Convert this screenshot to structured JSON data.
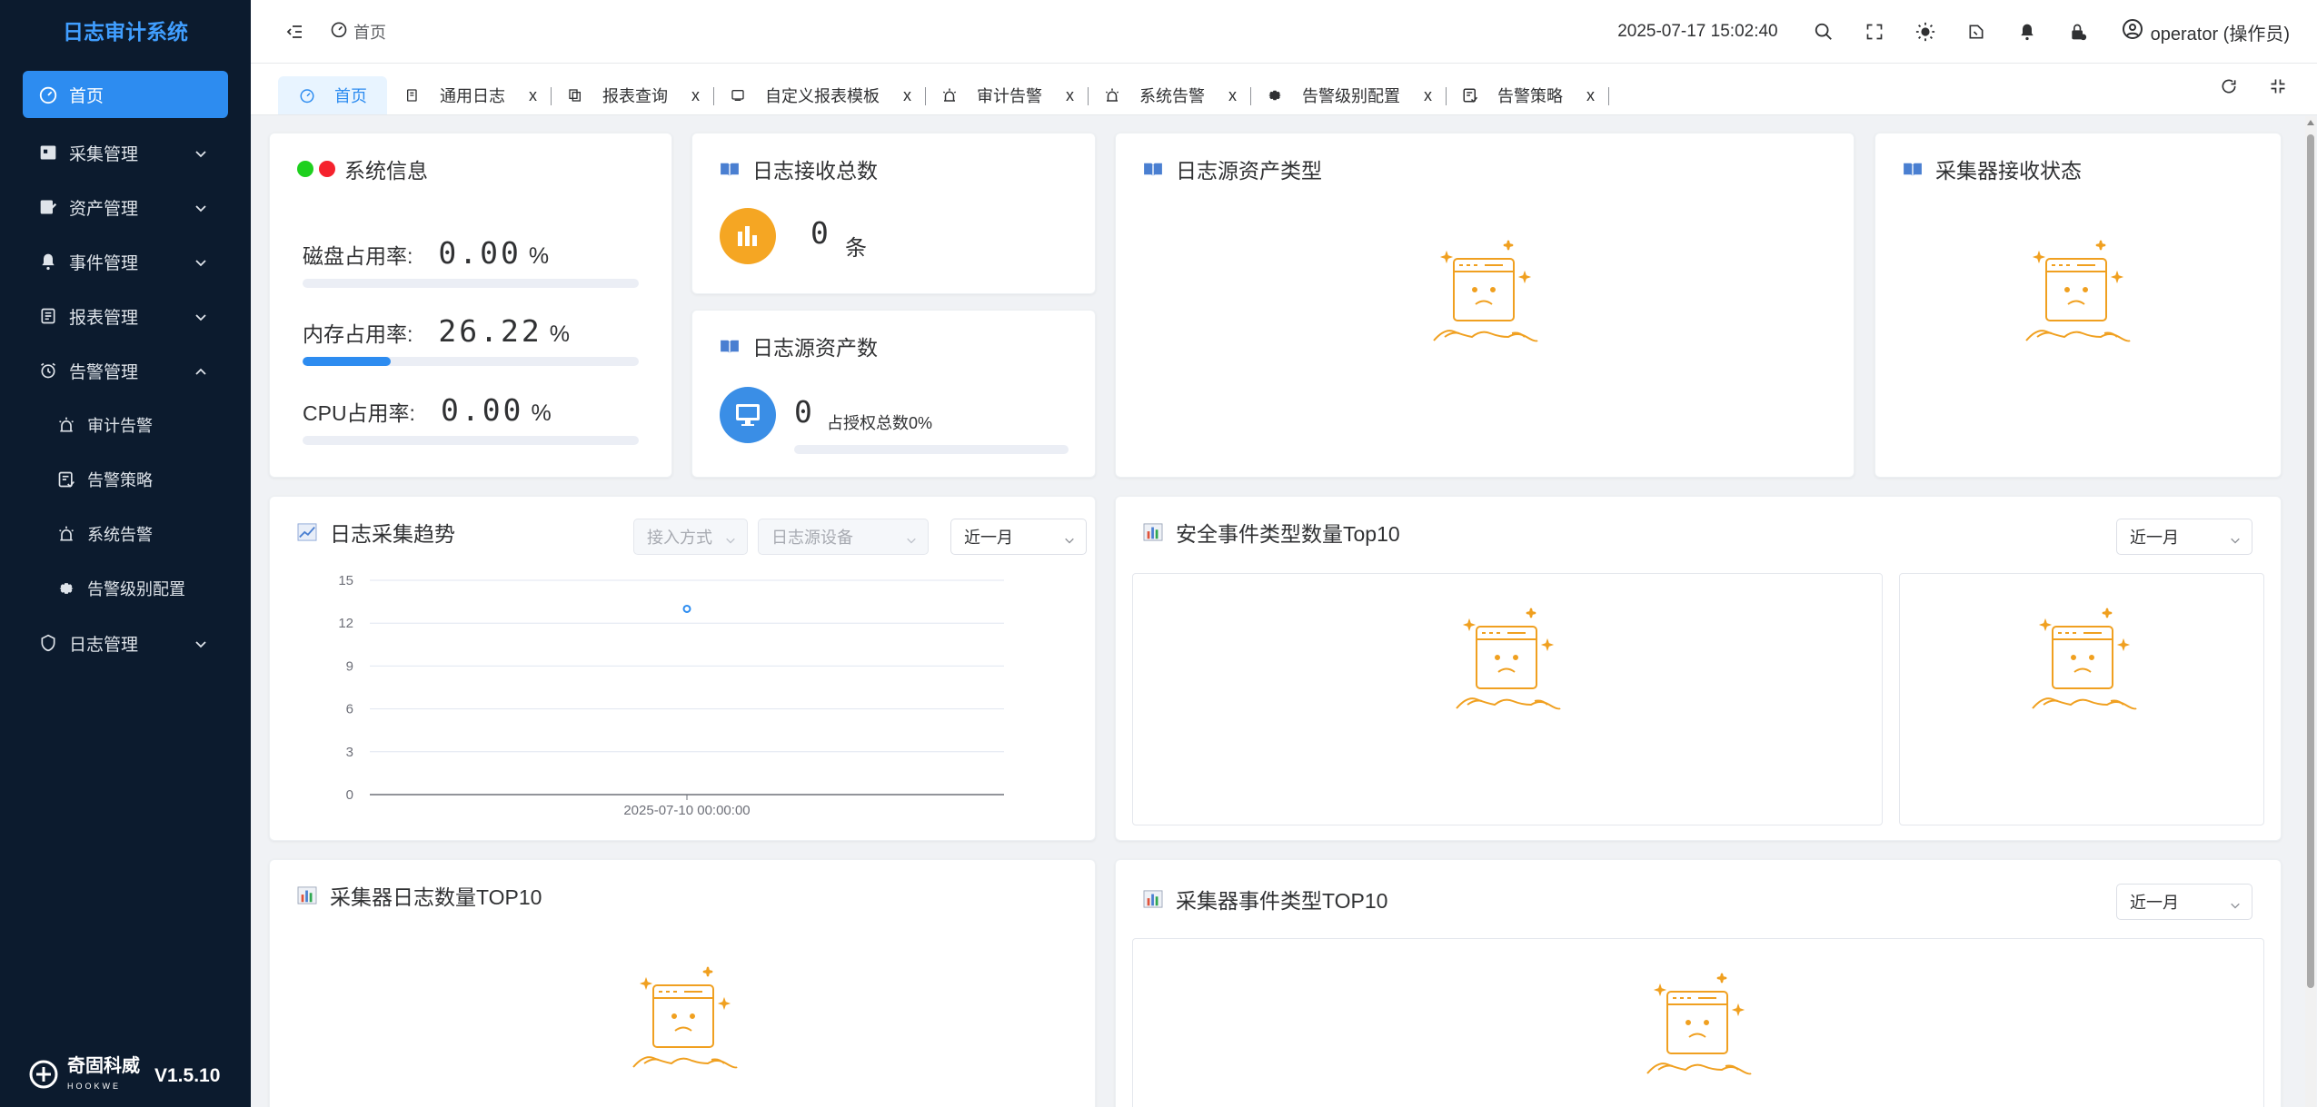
{
  "app": {
    "title": "日志审计系统",
    "version": "V1.5.10",
    "brand": "奇固科威",
    "brand_en": "HOOKWE"
  },
  "sidebar": {
    "items": [
      {
        "label": "首页"
      },
      {
        "label": "采集管理"
      },
      {
        "label": "资产管理"
      },
      {
        "label": "事件管理"
      },
      {
        "label": "报表管理"
      },
      {
        "label": "告警管理"
      },
      {
        "label": "审计告警"
      },
      {
        "label": "告警策略"
      },
      {
        "label": "系统告警"
      },
      {
        "label": "告警级别配置"
      },
      {
        "label": "日志管理"
      }
    ]
  },
  "header": {
    "breadcrumb": "首页",
    "datetime": "2025-07-17 15:02:40",
    "user": "operator (操作员)"
  },
  "tabs": [
    {
      "label": "首页"
    },
    {
      "label": "通用日志",
      "close": "x"
    },
    {
      "label": "报表查询",
      "close": "x"
    },
    {
      "label": "自定义报表模板",
      "close": "x"
    },
    {
      "label": "审计告警",
      "close": "x"
    },
    {
      "label": "系统告警",
      "close": "x"
    },
    {
      "label": "告警级别配置",
      "close": "x"
    },
    {
      "label": "告警策略",
      "close": "x"
    }
  ],
  "system_info": {
    "title": "系统信息",
    "status_colors": [
      "#1ed01e",
      "#f5222d"
    ],
    "disk": {
      "label": "磁盘占用率:",
      "value": "0.00",
      "unit": "%",
      "fraction": 0
    },
    "memory": {
      "label": "内存占用率:",
      "value": "26.22",
      "unit": "%",
      "fraction": 0.2622
    },
    "cpu": {
      "label": "CPU占用率:",
      "value": "0.00",
      "unit": "%",
      "fraction": 0
    }
  },
  "log_total": {
    "title": "日志接收总数",
    "value": "0",
    "unit": "条"
  },
  "asset_count": {
    "title": "日志源资产数",
    "value": "0",
    "note": "占授权总数0%",
    "fraction": 0
  },
  "asset_types": {
    "title": "日志源资产类型"
  },
  "collector_status": {
    "title": "采集器接收状态"
  },
  "trend": {
    "title": "日志采集趋势",
    "filters": {
      "access": "接入方式",
      "device": "日志源设备",
      "range": "近一月"
    }
  },
  "security_top10": {
    "title": "安全事件类型数量Top10",
    "range": "近一月"
  },
  "collector_log_top10": {
    "title": "采集器日志数量TOP10"
  },
  "collector_event_top10": {
    "title": "采集器事件类型TOP10",
    "range": "近一月"
  },
  "colors": {
    "accent": "#2d8cf0",
    "sidebar_bg": "#0c1b2e",
    "logo": "#409eff",
    "empty_icon": "#f0a020",
    "orange": "#f5a623"
  },
  "chart_data": {
    "type": "line",
    "x": [
      "2025-07-10 00:00:00"
    ],
    "series": [
      {
        "values": [
          13
        ]
      }
    ],
    "xlabel": "",
    "ylabel": "",
    "ylim": [
      0,
      15
    ],
    "yticks": [
      0,
      3,
      6,
      9,
      12,
      15
    ],
    "grid": true
  }
}
